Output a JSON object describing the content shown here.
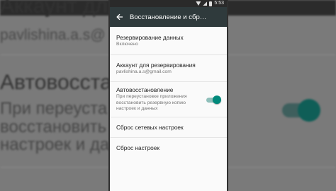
{
  "background": {
    "line1": "Аккаунт для",
    "line2": "pavlishina.a.s@",
    "line3": "Автовосста",
    "line4": "При переуста",
    "line5": "восстановить",
    "line6": "настроек и да"
  },
  "status_bar": {
    "time": "5:53"
  },
  "app_bar": {
    "title": "Восстановление и сбр…",
    "back_icon": "arrow-left-icon"
  },
  "settings": {
    "backup": {
      "title": "Резервирование данных",
      "subtitle": "Включено"
    },
    "account": {
      "title": "Аккаунт для резервирования",
      "subtitle": "pavlishina.a.s@gmail.com"
    },
    "autorestore": {
      "title": "Автовосстановление",
      "subtitle": "При переустановке приложения восстановить резервную копию настроек и данных",
      "enabled": true
    },
    "network_reset": {
      "title": "Сброс сетевых настроек"
    },
    "factory_reset": {
      "title": "Сброс настроек"
    }
  },
  "colors": {
    "app_bar": "#2f3a3c",
    "accent": "#00897b",
    "toggle_track": "#8fbfba"
  }
}
